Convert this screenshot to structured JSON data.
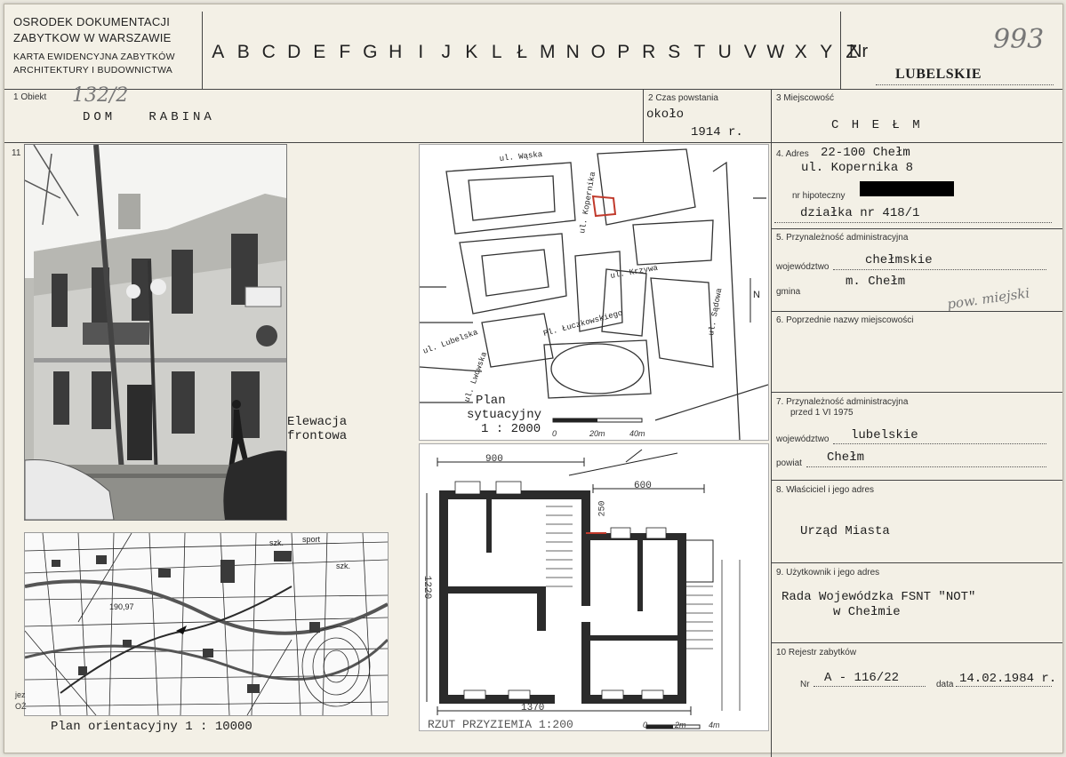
{
  "header": {
    "institution_line1": "OSRODEK DOKUMENTACJI",
    "institution_line2": "ZABYTKOW W WARSZAWIE",
    "card_type_line1": "KARTA EWIDENCYJNA ZABYTKÓW",
    "card_type_line2": "ARCHITEKTURY I BUDOWNICTWA",
    "alphabet": [
      "A",
      "B",
      "C",
      "D",
      "E",
      "F",
      "G",
      "H",
      "I",
      "J",
      "K",
      "L",
      "Ł",
      "M",
      "N",
      "O",
      "P",
      "R",
      "S",
      "T",
      "U",
      "V",
      "W",
      "X",
      "Y",
      "Z"
    ],
    "nr_label": "Nr",
    "nr_handwritten": "993",
    "voivodeship": "LUBELSKIE"
  },
  "obiekt": {
    "label": "1 Obiekt",
    "number_handwritten": "132/2",
    "value": "DOM   RABINA"
  },
  "czas": {
    "label": "2 Czas powstania",
    "value_line1": "około",
    "value_line2": "1914 r."
  },
  "miejscowosc": {
    "label": "3 Miejscowość",
    "value": "C H E Ł M"
  },
  "photo_field_number": "11",
  "captions": {
    "elewacja_line1": "Elewacja",
    "elewacja_line2": "frontowa",
    "plan_sytuacyjny_line1": "Plan",
    "plan_sytuacyjny_line2": "sytuacyjny",
    "plan_sytuacyjny_scale": "1 : 2000",
    "plan_orientacyjny": "Plan orientacyjny 1 : 10000",
    "rzut": "RZUT PRZYZIEMIA 1:200"
  },
  "site_plan": {
    "streets": [
      "ul. Wąska",
      "ul. Kopernika",
      "ul. Krzywa",
      "Pl. Łuczkowskiego",
      "ul. Lubelska",
      "ul. Lwowska",
      "ul. Sądowa"
    ],
    "north": "N",
    "scale_marks": [
      "0",
      "20m",
      "40m"
    ]
  },
  "floor_plan": {
    "dims": [
      "900",
      "600",
      "250",
      "1370",
      "1220"
    ],
    "scale_marks": [
      "0",
      "2m",
      "4m"
    ]
  },
  "orient_map": {
    "labels": [
      "szk.",
      "sport",
      "szk.",
      "190,97"
    ],
    "edge_labels": [
      "jez",
      "OŻ"
    ]
  },
  "adres": {
    "label": "4. Adres",
    "line1": "22-100 Chełm",
    "line2": "ul. Kopernika 8",
    "hipoteczny_label": "nr hipoteczny",
    "dzialka": "działka nr 418/1"
  },
  "przynaleznosc": {
    "label": "5. Przynależność administracyjna",
    "woj_label": "województwo",
    "woj_value": "chełmskie",
    "gmina_label": "gmina",
    "gmina_value": "m. Chełm",
    "gmina_note": "pow. miejski"
  },
  "poprzednie": {
    "label": "6. Poprzednie nazwy miejscowości"
  },
  "przynaleznosc1975": {
    "label_line1": "7. Przynależność administracyjna",
    "label_line2": "przed 1 VI 1975",
    "woj_label": "województwo",
    "woj_value": "lubelskie",
    "powiat_label": "powiat",
    "powiat_value": "Chełm"
  },
  "wlasciciel": {
    "label": "8. Właściciel i jego adres",
    "value": "Urząd Miasta"
  },
  "uzytkownik": {
    "label": "9. Użytkownik i jego adres",
    "value_line1": "Rada Wojewódzka FSNT \"NOT\"",
    "value_line2": "w Chełmie"
  },
  "rejestr": {
    "label": "10 Rejestr zabytków",
    "nr_label": "Nr",
    "nr_value": "A - 116/22",
    "data_label": "data",
    "data_value": "14.02.1984 r."
  },
  "colors": {
    "paper": "#f3f0e6",
    "ink": "#222222",
    "pencil": "#777777",
    "redaction": "#000000"
  }
}
